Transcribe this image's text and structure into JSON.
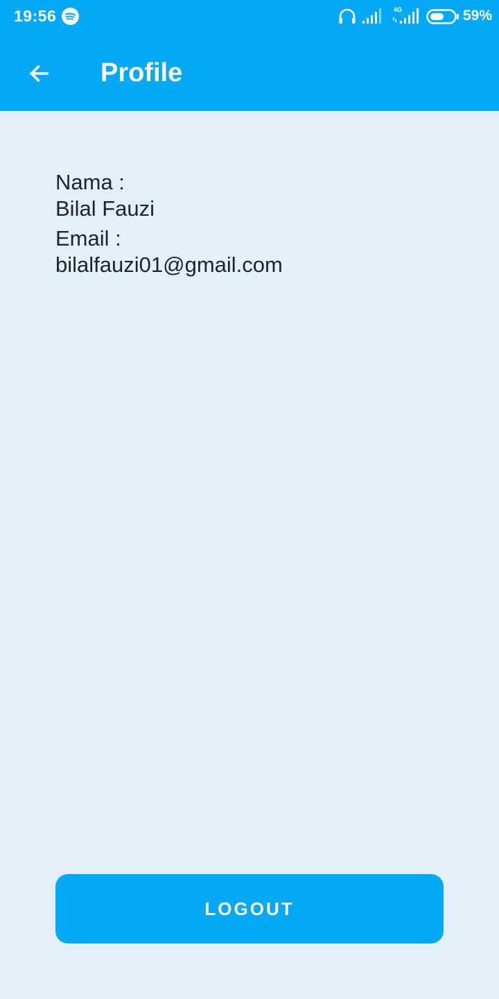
{
  "status_bar": {
    "time": "19:56",
    "network_type": "4G",
    "battery_percent": "59%",
    "battery_level": 0.59,
    "icons": [
      "spotify-icon",
      "headphones-icon",
      "signal-icon",
      "signal-4g-icon",
      "battery-icon"
    ]
  },
  "toolbar": {
    "back_icon": "arrow-left-icon",
    "title": "Profile"
  },
  "profile": {
    "name_label": "Nama :",
    "name_value": "Bilal Fauzi",
    "email_label": "Email :",
    "email_value": "bilalfauzi01@gmail.com"
  },
  "actions": {
    "logout_label": "LOGOUT"
  },
  "colors": {
    "primary": "#03a9f4",
    "background": "#e3f0fa",
    "text": "#1e242b",
    "on_primary": "#ffffff"
  }
}
